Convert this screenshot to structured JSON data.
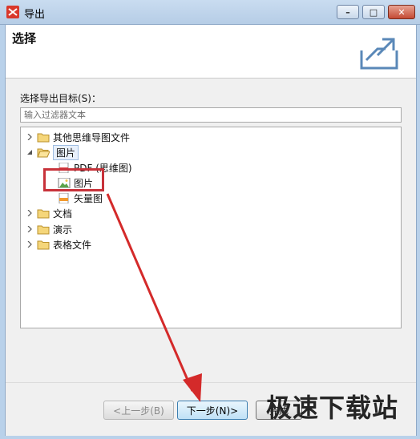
{
  "window": {
    "title": "导出",
    "minimize": "–",
    "maximize": "□",
    "close": "✕"
  },
  "header": {
    "title": "选择"
  },
  "main": {
    "select_label": "选择导出目标(S)：",
    "filter_placeholder": "输入过滤器文本",
    "tree": {
      "item_1": "其他思维导图文件",
      "item_2": "图片",
      "item_2_children": [
        "PDF (思维图)",
        "图片",
        "矢量图"
      ],
      "item_3": "文档",
      "item_4": "演示",
      "item_5": "表格文件"
    }
  },
  "footer": {
    "prev": "<上一步(B)",
    "next": "下一步(N)>",
    "finish": "完成"
  },
  "watermark": "极速下载站",
  "colors": {
    "accent": "#c8323a",
    "window": "#b9d1ea"
  }
}
